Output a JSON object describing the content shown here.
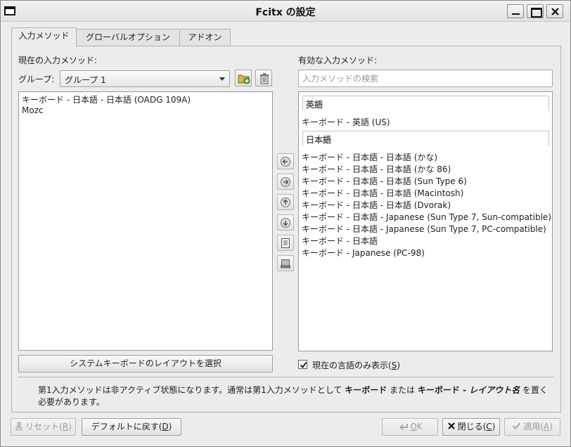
{
  "window": {
    "title": "Fcitx の設定"
  },
  "tabs": [
    {
      "label": "入力メソッド"
    },
    {
      "label": "グローバルオプション"
    },
    {
      "label": "アドオン"
    }
  ],
  "left": {
    "heading": "現在の入力メソッド:",
    "group_label": "グループ:",
    "group_value": "グループ 1",
    "items": [
      "キーボード - 日本語 - 日本語 (OADG 109A)",
      "Mozc"
    ],
    "layout_button": "システムキーボードのレイアウトを選択"
  },
  "right": {
    "heading": "有効な入力メソッド:",
    "search_placeholder": "入力メソッドの検索",
    "groups": [
      {
        "name": "英語",
        "items": [
          "キーボード - 英語 (US)"
        ]
      },
      {
        "name": "日本語",
        "items": [
          "キーボード - 日本語 - 日本語 (かな)",
          "キーボード - 日本語 - 日本語 (かな 86)",
          "キーボード - 日本語 - 日本語 (Sun Type 6)",
          "キーボード - 日本語 - 日本語 (Macintosh)",
          "キーボード - 日本語 - 日本語 (Dvorak)",
          "キーボード - 日本語 - Japanese (Sun Type 7, Sun-compatible)",
          "キーボード - 日本語 - Japanese (Sun Type 7, PC-compatible)",
          "キーボード - 日本語",
          "キーボード - Japanese (PC-98)"
        ]
      }
    ],
    "checkbox_label": "現在の言語のみ表示(",
    "checkbox_mnemonic": "S",
    "checkbox_close": ")",
    "checkbox_checked": true
  },
  "info": {
    "part1": "第1入力メソッドは非アクティブ状態になります。通常は第1入力メソッドとして ",
    "bold1": "キーボード",
    "part2": " または ",
    "bold2": "キーボード - ",
    "bold_italic": "レイアウト名",
    "part3": " を置く",
    "line2": "必要があります。"
  },
  "buttons": {
    "reset": "リセット(",
    "reset_key": "R",
    "default": "デフォルトに戻す(",
    "default_key": "D",
    "ok": "OK",
    "ok_key": "O",
    "close": "閉じる(",
    "close_key": "C",
    "apply": "適用(",
    "apply_key": "A",
    "paren_close": ")"
  }
}
